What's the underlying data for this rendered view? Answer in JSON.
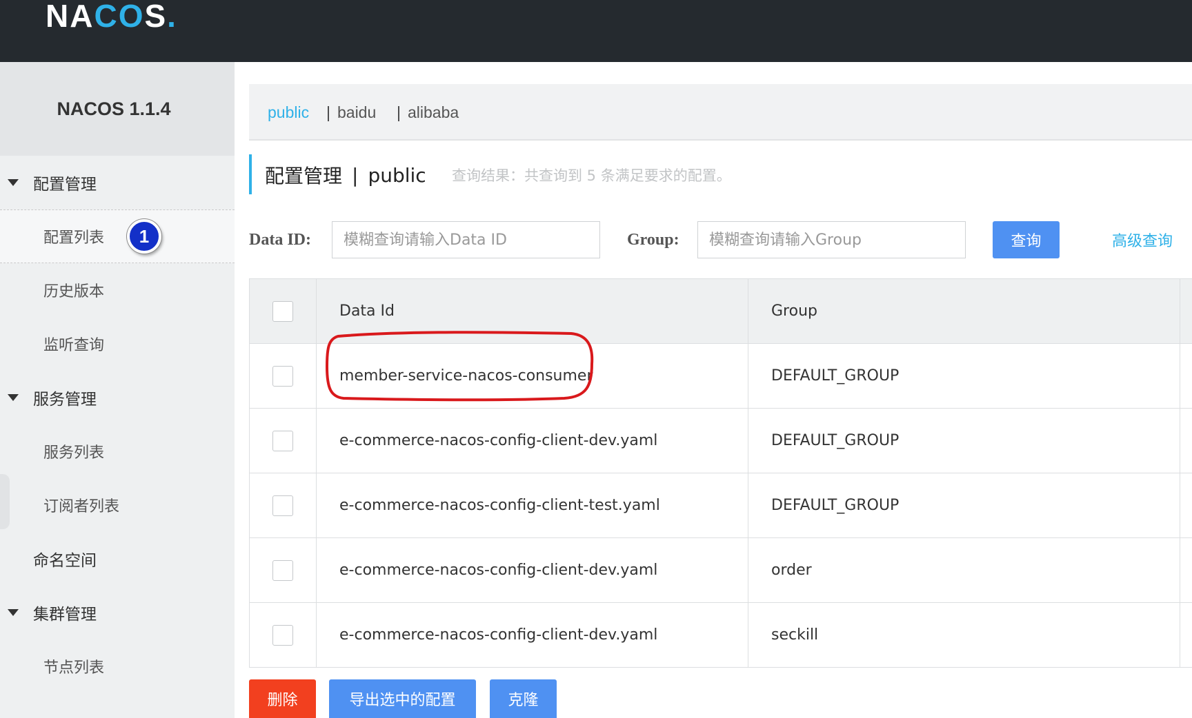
{
  "header": {
    "logo": {
      "part1": "NA",
      "part2": "C",
      "part3": "O",
      "part4": "S",
      "part5": "."
    }
  },
  "sidebar": {
    "title": "NACOS 1.1.4",
    "groups": [
      {
        "label": "配置管理",
        "items": [
          {
            "label": "配置列表",
            "badge": "1"
          },
          {
            "label": "历史版本"
          },
          {
            "label": "监听查询"
          }
        ]
      },
      {
        "label": "服务管理",
        "items": [
          {
            "label": "服务列表"
          },
          {
            "label": "订阅者列表"
          }
        ]
      },
      {
        "label": "命名空间"
      },
      {
        "label": "集群管理",
        "items": [
          {
            "label": "节点列表"
          }
        ]
      }
    ]
  },
  "namespaces": [
    {
      "label": "public",
      "active": true
    },
    {
      "label": "baidu",
      "sep": "|"
    },
    {
      "label": "alibaba",
      "sep": "|"
    }
  ],
  "page": {
    "title": "配置管理",
    "pipe": "|",
    "namespace": "public",
    "result_hint": "查询结果：共查询到 5 条满足要求的配置。"
  },
  "search": {
    "dataid_label": "Data ID:",
    "dataid_placeholder": "模糊查询请输入Data ID",
    "group_label": "Group:",
    "group_placeholder": "模糊查询请输入Group",
    "query_button": "查询",
    "advanced_link": "高级查询"
  },
  "table": {
    "columns": [
      "Data Id",
      "Group"
    ],
    "rows": [
      {
        "data_id": "member-service-nacos-consumer",
        "group": "DEFAULT_GROUP"
      },
      {
        "data_id": "e-commerce-nacos-config-client-dev.yaml",
        "group": "DEFAULT_GROUP"
      },
      {
        "data_id": "e-commerce-nacos-config-client-test.yaml",
        "group": "DEFAULT_GROUP"
      },
      {
        "data_id": "e-commerce-nacos-config-client-dev.yaml",
        "group": "order"
      },
      {
        "data_id": "e-commerce-nacos-config-client-dev.yaml",
        "group": "seckill"
      }
    ]
  },
  "actions": {
    "delete": "删除",
    "export_selected": "导出选中的配置",
    "clone": "克隆"
  },
  "colors": {
    "accent": "#2fb1e8",
    "primary_button": "#4f91f2",
    "danger_button": "#f2401f",
    "annotation": "#d9191c",
    "badge": "#1330c8"
  }
}
